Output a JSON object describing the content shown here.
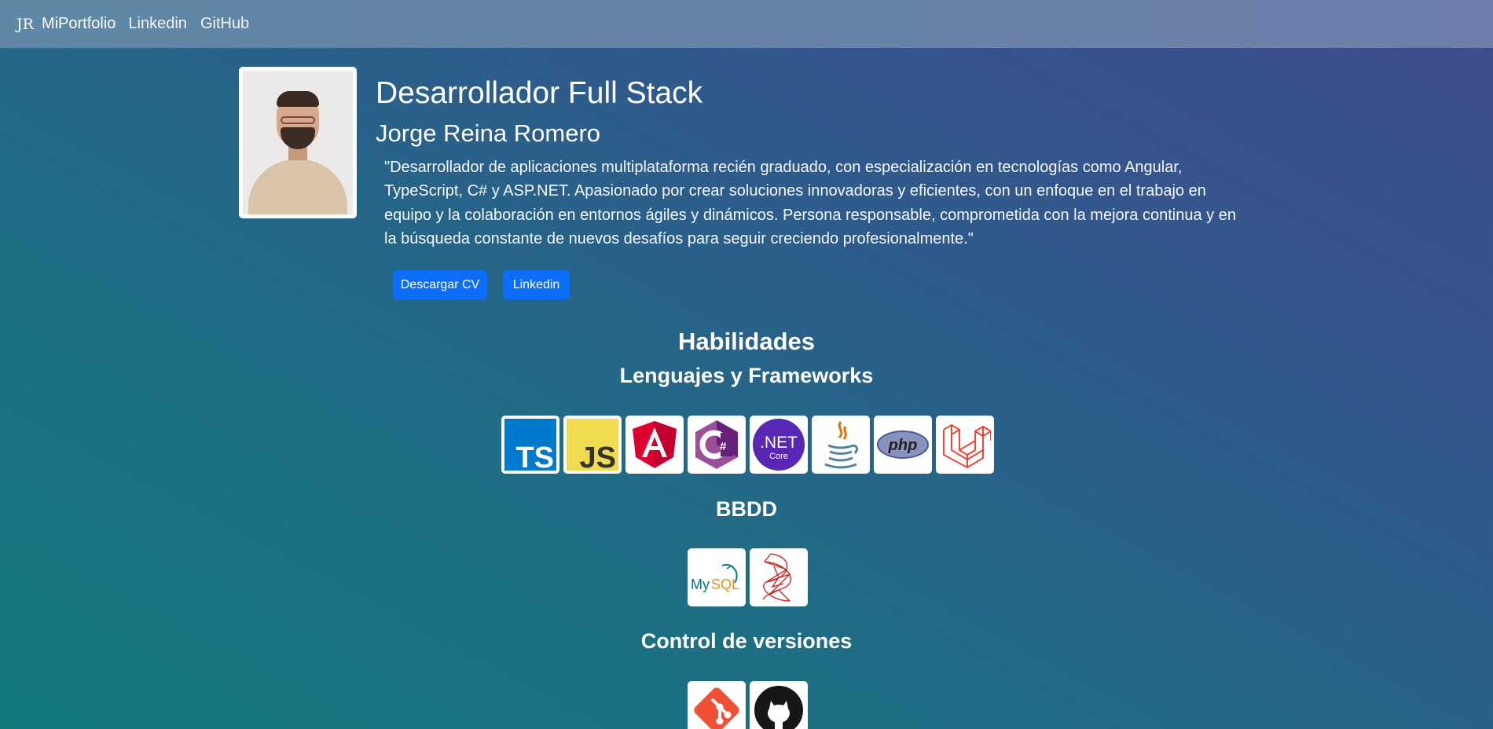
{
  "navbar": {
    "logo": "JR",
    "brand": "MiPortfolio",
    "links": [
      "Linkedin",
      "GitHub"
    ]
  },
  "profile": {
    "title": "Desarrollador Full Stack",
    "name": "Jorge Reina Romero",
    "bio": "\"Desarrollador de aplicaciones multiplataforma recién graduado, con especialización en tecnologías como Angular, TypeScript, C# y ASP.NET. Apasionado por crear soluciones innovadoras y eficientes, con un enfoque en el trabajo en equipo y la colaboración en entornos ágiles y dinámicos. Persona responsable, comprometida con la mejora continua y en la búsqueda constante de nuevos desafíos para seguir creciendo profesionalmente.\"",
    "buttons": {
      "cv": "Descargar CV",
      "linkedin": "Linkedin"
    }
  },
  "skills": {
    "heading": "Habilidades",
    "languages": {
      "heading": "Lenguajes y Frameworks",
      "icons": [
        "typescript-icon",
        "javascript-icon",
        "angular-icon",
        "csharp-icon",
        "dotnet-core-icon",
        "java-icon",
        "php-icon",
        "laravel-icon"
      ],
      "icon_text": {
        "ts": "TS",
        "js": "JS",
        "net": ".NET",
        "core": "Core",
        "php": "php"
      }
    },
    "databases": {
      "heading": "BBDD",
      "icons": [
        "mysql-icon",
        "sql-server-icon"
      ],
      "icon_text": {
        "my": "My",
        "sql": "SQL"
      }
    },
    "version_control": {
      "heading": "Control de versiones",
      "icons": [
        "git-icon",
        "github-icon"
      ]
    }
  },
  "colors": {
    "button": "#0d6efd",
    "typescript": "#007acc",
    "javascript": "#f0db4f",
    "angular": "#dd0031",
    "csharp": "#68217a",
    "dotnet": "#512bd4",
    "git": "#f05033",
    "laravel": "#ff2d20"
  }
}
